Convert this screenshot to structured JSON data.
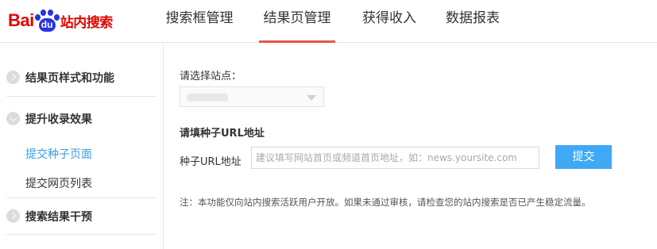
{
  "logo": {
    "bai": "Bai",
    "du": "du",
    "product": "站内搜索",
    "brand_red": "#e10602",
    "brand_blue": "#2932e1"
  },
  "nav": {
    "tabs": [
      {
        "label": "搜索框管理",
        "active": false
      },
      {
        "label": "结果页管理",
        "active": true
      },
      {
        "label": "获得收入",
        "active": false
      },
      {
        "label": "数据报表",
        "active": false
      }
    ],
    "active_underline_color": "#e5544b"
  },
  "sidebar": {
    "sections": [
      {
        "label": "结果页样式和功能",
        "icon": "chevron-right-icon"
      },
      {
        "label": "提升收录效果",
        "icon": "chevron-down-icon"
      },
      {
        "label": "搜索结果干预",
        "icon": "chevron-right-icon"
      }
    ],
    "links": [
      {
        "label": "提交种子页面",
        "active": true
      },
      {
        "label": "提交网页列表",
        "active": false
      }
    ],
    "active_link_color": "#3b9de1"
  },
  "main": {
    "site_label": "请选择站点：",
    "site_select_value": "",
    "heading": "请填种子URL地址",
    "url_label": "种子URL地址",
    "url_input_value": "",
    "url_placeholder": "建议填写网站首页或频道首页地址，如：news.yoursite.com",
    "submit_label": "提交",
    "submit_color": "#3ea9f5",
    "note": "注：本功能仅向站内搜索活跃用户开放。如果未通过审核，请检查您的站内搜索是否已产生稳定流量。"
  }
}
